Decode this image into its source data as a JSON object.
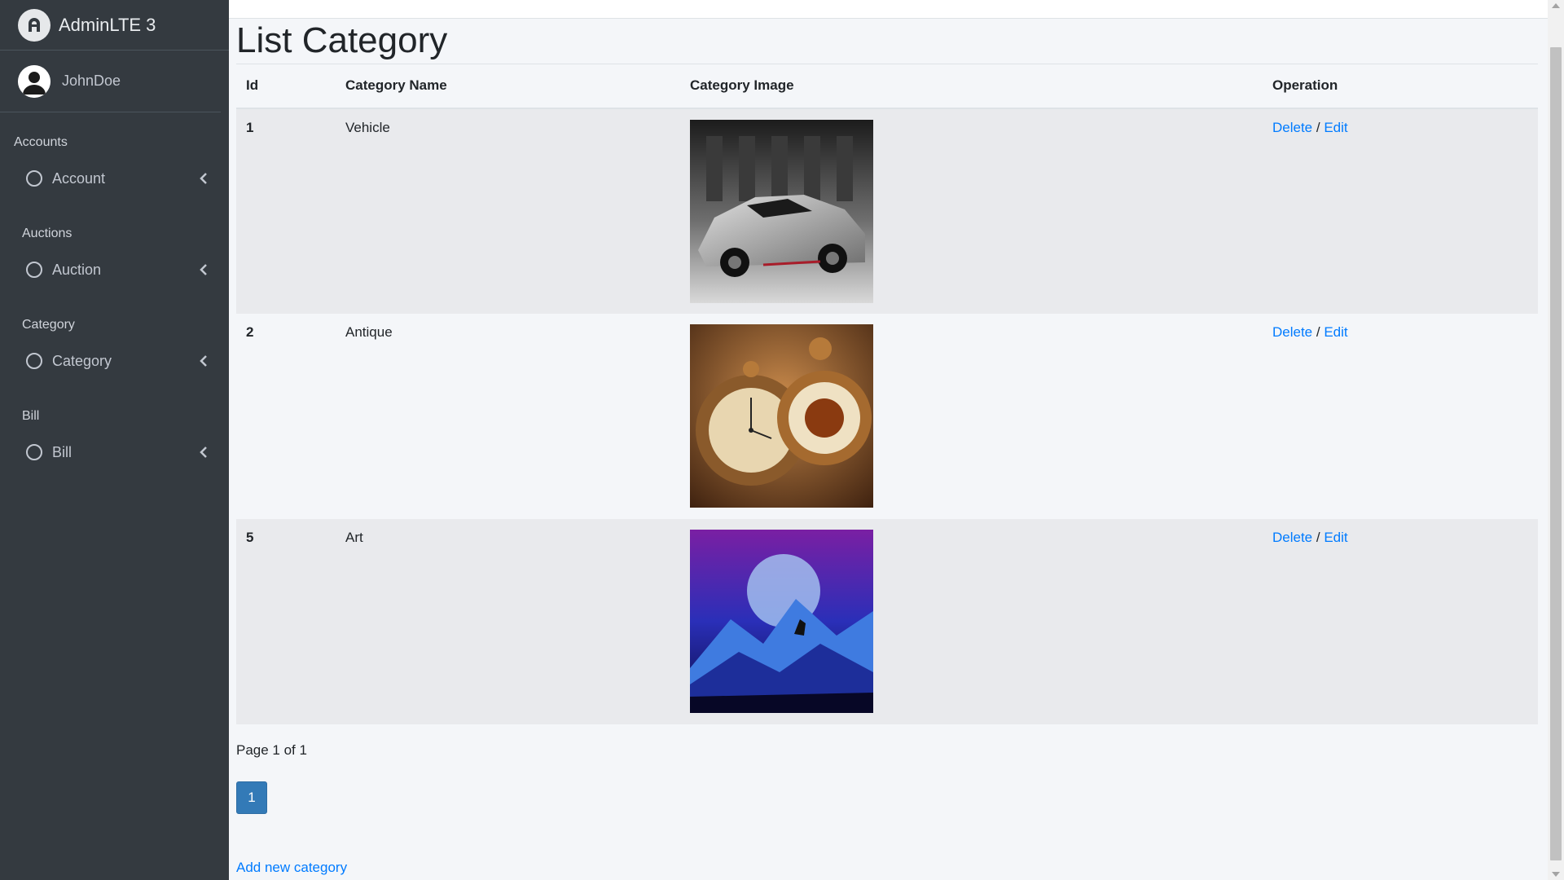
{
  "sidebar": {
    "brand": "AdminLTE 3",
    "user": "JohnDoe",
    "groups": [
      {
        "header": "Accounts",
        "item": "Account"
      },
      {
        "header": "Auctions",
        "item": "Auction"
      },
      {
        "header": "Category",
        "item": "Category"
      },
      {
        "header": "Bill",
        "item": "Bill"
      }
    ]
  },
  "main": {
    "title": "List Category",
    "columns": [
      "Id",
      "Category Name",
      "Category Image",
      "Operation"
    ],
    "rows": [
      {
        "id": "1",
        "name": "Vehicle",
        "image": "car-image",
        "delete": "Delete",
        "edit": "Edit"
      },
      {
        "id": "2",
        "name": "Antique",
        "image": "pocket-watch-image",
        "delete": "Delete",
        "edit": "Edit"
      },
      {
        "id": "5",
        "name": "Art",
        "image": "wolf-moon-art-image",
        "delete": "Delete",
        "edit": "Edit"
      }
    ],
    "separator": "/",
    "pagination_info": "Page 1 of 1",
    "page_button": "1",
    "add_link": "Add new category"
  },
  "colors": {
    "sidebar_bg": "#343a40",
    "link": "#007bff",
    "page_button": "#337ab7"
  }
}
